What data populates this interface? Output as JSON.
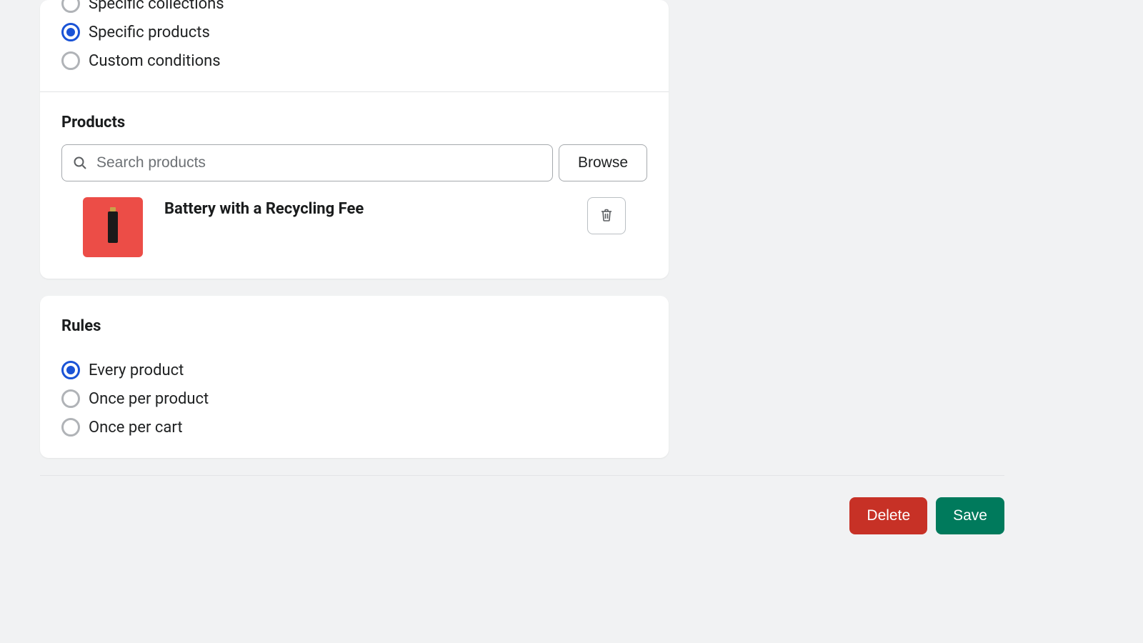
{
  "applies_to": {
    "options": [
      {
        "label": "Specific collections",
        "selected": false
      },
      {
        "label": "Specific products",
        "selected": true
      },
      {
        "label": "Custom conditions",
        "selected": false
      }
    ]
  },
  "products": {
    "heading": "Products",
    "search_placeholder": "Search products",
    "browse_label": "Browse",
    "items": [
      {
        "name": "Battery with a Recycling Fee"
      }
    ]
  },
  "rules": {
    "heading": "Rules",
    "options": [
      {
        "label": "Every product",
        "selected": true
      },
      {
        "label": "Once per product",
        "selected": false
      },
      {
        "label": "Once per cart",
        "selected": false
      }
    ]
  },
  "footer": {
    "delete_label": "Delete",
    "save_label": "Save"
  }
}
